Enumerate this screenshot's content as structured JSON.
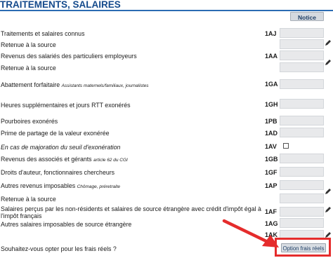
{
  "section": {
    "title": "TRAITEMENTS, SALAIRES",
    "notice_label": "Notice"
  },
  "rows": [
    {
      "label": "Traitements et salaires connus",
      "note": "",
      "code": "1AJ"
    },
    {
      "label": "Retenue à la source",
      "note": "",
      "code": ""
    },
    {
      "label": "Revenus des salariés des particuliers employeurs",
      "note": "",
      "code": "1AA"
    },
    {
      "label": "Retenue à la source",
      "note": "",
      "code": ""
    },
    {
      "label": "Abattement forfaitaire",
      "note": "Assistants maternels/familiaux, journalistes",
      "code": "1GA"
    },
    {
      "label": "Heures supplémentaires et jours RTT exonérés",
      "note": "",
      "code": "1GH"
    },
    {
      "label": "Pourboires exonérés",
      "note": "",
      "code": "1PB"
    },
    {
      "label": "Prime de partage de la valeur exonérée",
      "note": "",
      "code": "1AD"
    },
    {
      "label": "En cas de majoration du seuil d'exonération",
      "note": "",
      "code": "1AV"
    },
    {
      "label": "Revenus des associés et gérants",
      "note": "article 62 du CGI",
      "code": "1GB"
    },
    {
      "label": "Droits d'auteur, fonctionnaires chercheurs",
      "note": "",
      "code": "1GF"
    },
    {
      "label": "Autres revenus imposables",
      "note": "Chômage, préretraite",
      "code": "1AP"
    },
    {
      "label": "Retenue à la source",
      "note": "",
      "code": ""
    },
    {
      "label": "Salaires perçus par les non-résidents et salaires de source étrangère avec crédit d'impôt égal à",
      "note": "",
      "code": "1AF"
    },
    {
      "label": "l'impôt français",
      "note": "",
      "code": ""
    },
    {
      "label": "Autres salaires imposables de source étrangère",
      "note": "",
      "code": "1AG"
    },
    {
      "label": "",
      "note": "",
      "code": "1AK"
    }
  ],
  "frais_reels": {
    "question": "Souhaitez-vous opter pour les frais réels ?",
    "button_label": "Option frais réels"
  },
  "annotation": {
    "color": "#e52c2c"
  }
}
